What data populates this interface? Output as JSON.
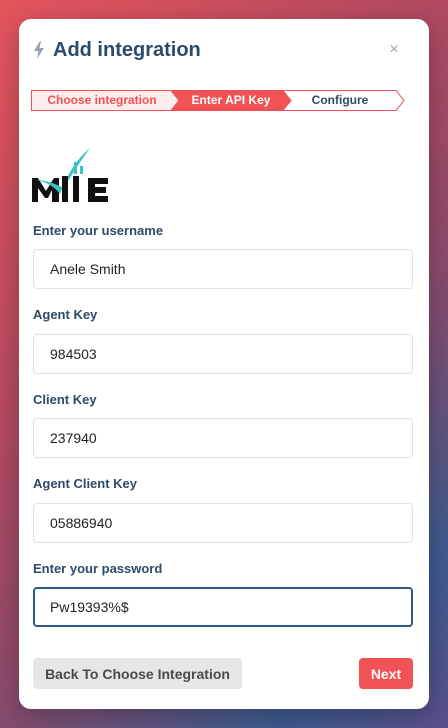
{
  "header": {
    "title": "Add integration",
    "icon": "lightning-bolt-icon",
    "close_icon": "close-icon",
    "close_symbol": "×"
  },
  "stepper": {
    "steps": [
      {
        "label": "Choose integration",
        "state": "completed"
      },
      {
        "label": "Enter API Key",
        "state": "active"
      },
      {
        "label": "Configure",
        "state": "upcoming"
      }
    ]
  },
  "logo": {
    "icon": "mie-logo-icon",
    "text": "MIE"
  },
  "form": {
    "fields": [
      {
        "label": "Enter your username",
        "value": "Anele Smith"
      },
      {
        "label": "Agent Key",
        "value": "984503"
      },
      {
        "label": "Client Key",
        "value": "237940"
      },
      {
        "label": "Agent Client Key",
        "value": "05886940"
      },
      {
        "label": "Enter your password",
        "value": "Pw19393%$"
      }
    ]
  },
  "footer": {
    "back_label": "Back To Choose Integration",
    "next_label": "Next"
  },
  "colors": {
    "accent": "#f05256",
    "heading": "#2c4a6b",
    "focus_border": "#2d5b87"
  }
}
